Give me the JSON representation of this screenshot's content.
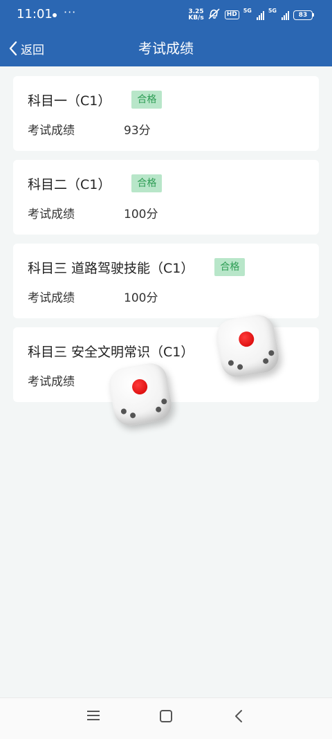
{
  "status_bar": {
    "time": "11:01",
    "more": "···",
    "net_speed_value": "3.25",
    "net_speed_unit": "KB/s",
    "hd": "HD",
    "signal1_label": "5G",
    "signal2_label": "5G",
    "battery": "83"
  },
  "header": {
    "back_label": "返回",
    "title": "考试成绩"
  },
  "subjects": [
    {
      "name": "科目一（C1）",
      "badge": "合格",
      "score_label": "考试成绩",
      "score": "93分"
    },
    {
      "name": "科目二（C1）",
      "badge": "合格",
      "score_label": "考试成绩",
      "score": "100分"
    },
    {
      "name": "科目三 道路驾驶技能（C1）",
      "badge": "合格",
      "score_label": "考试成绩",
      "score": "100分"
    },
    {
      "name": "科目三 安全文明常识（C1）",
      "score_label": "考试成绩"
    }
  ],
  "colors": {
    "header_bg": "#2b67b3",
    "badge_bg": "#b8e6c9",
    "badge_text": "#2e9d55",
    "page_bg": "#f3f6f6"
  },
  "icons": [
    "back-chevron-icon",
    "menu-icon",
    "home-icon",
    "back-arrow-icon",
    "dice-icon"
  ]
}
